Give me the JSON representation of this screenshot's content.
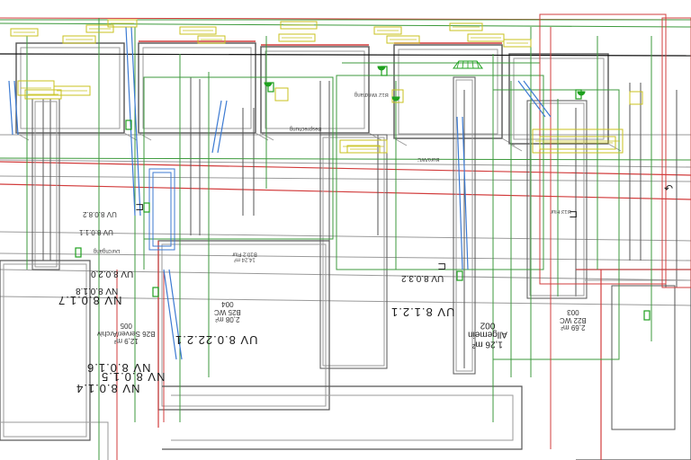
{
  "colors": {
    "walls": "#555555",
    "walls_light": "#9a9a9a",
    "green_volume": "#3c9a3c",
    "red_volume": "#d23c3c",
    "yellow_fixture": "#c8c21e",
    "blue_duct": "#3c7ad2",
    "green_device": "#1ea01e",
    "background": "#ffffff"
  },
  "labels": {
    "nv_8_0_1_4": "NV 8.0.1.4",
    "nv_8_0_1_5": "NV 8.0.1.5",
    "nv_8_0_1_6": "NV 8.0.1.6",
    "nv_8_0_1_7": "NV 8.0.1.7",
    "nv_8_0_1_8": "NV 8.0.1.8",
    "uv_8_0_2_0": "UV 8.0.2.0",
    "uv_8_0_22_2_1": "UV 8.0.22.2.1",
    "uv_8_1_2_1": "UV 8.1.2.1",
    "uv_8_0_3_2": "UV 8.0.3.2",
    "uv_8_0_8_2": "UV 8.0.8.2",
    "uv_8_0_1_1": "UV 8.0.1.1",
    "room_005": {
      "number": "005",
      "name": "B26 Server/Archiv",
      "area": "12,9 m²"
    },
    "room_004": {
      "number": "004",
      "name": "B25 WC",
      "area": "2,08 m²"
    },
    "room_002": {
      "number": "002",
      "name": "Allgemein",
      "area": "1,26 m²"
    },
    "room_003": {
      "number": "003",
      "name": "B22 WC",
      "area": "2,69 m²"
    },
    "flur": {
      "name": "B10.2 Flur",
      "area": "14,24 m²"
    },
    "besprechung": "Besprechung",
    "buero_wc": "Büro/WC",
    "upper_note_1": "B12 Windfang",
    "upper_note_2": "B13 Flur",
    "upper_note_3": "Durchgang"
  }
}
